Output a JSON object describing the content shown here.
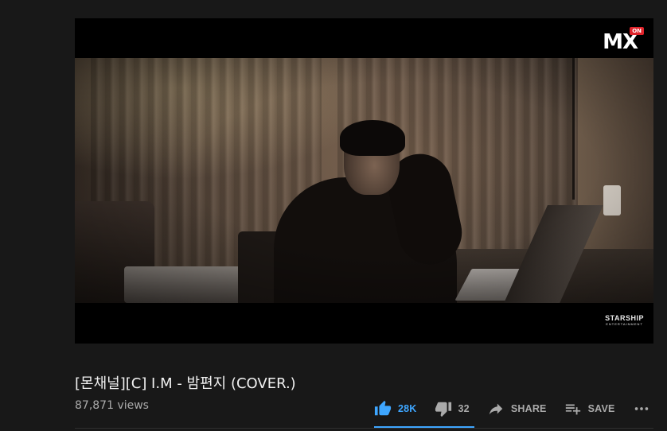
{
  "video": {
    "channel_logo": "MX",
    "channel_logo_badge": "ON",
    "watermark": "STARSHIP",
    "watermark_sub": "ENTERTAINMENT"
  },
  "info": {
    "title": "[몬채널][C] I.M - 밤편지 (COVER.)",
    "views": "87,871 views"
  },
  "actions": {
    "like_count": "28K",
    "dislike_count": "32",
    "share_label": "SHARE",
    "save_label": "SAVE"
  },
  "icons": {
    "like": "thumb-up-icon",
    "dislike": "thumb-down-icon",
    "share": "share-arrow-icon",
    "save": "playlist-add-icon",
    "more": "more-horizontal-icon"
  },
  "colors": {
    "background": "#181818",
    "accent": "#3ea6ff",
    "text_primary": "#f1f1f1",
    "text_secondary": "#aaaaaa"
  }
}
